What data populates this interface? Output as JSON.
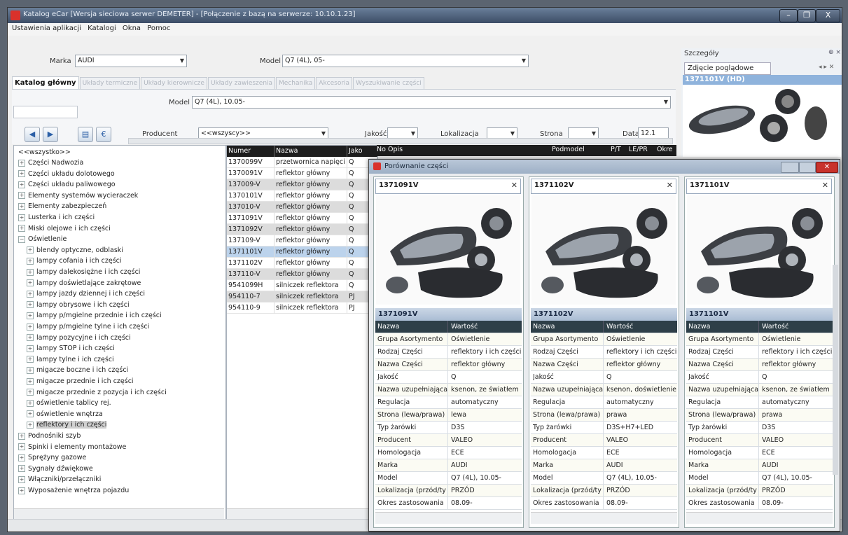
{
  "window": {
    "title": "Katalog eCar [Wersja sieciowa serwer DEMETER]  -  [Połączenie z bazą na serwerze: 10.10.1.23]",
    "minimize": "–",
    "maximize": "❐",
    "close": "X"
  },
  "menu": [
    "Ustawienia aplikacji",
    "Katalogi",
    "Okna",
    "Pomoc"
  ],
  "top_filters": {
    "marka_label": "Marka",
    "marka_value": "AUDI",
    "model_label": "Model",
    "model_value": "Q7 (4L), 05-"
  },
  "tabs": [
    "Katalog główny",
    "Układy termiczne",
    "Układy kierownicze",
    "Układy zawieszenia",
    "Mechanika",
    "Akcesoria",
    "Wyszukiwanie części"
  ],
  "filters": {
    "model_label": "Model",
    "model_value": "Q7 (4L), 10.05-",
    "producent_label": "Producent",
    "producent_value": "<<wszyscy>>",
    "jakosc_label": "Jakość",
    "lokalizacja_label": "Lokalizacja",
    "strona_label": "Strona",
    "data_label": "Data",
    "data_value": "12.1"
  },
  "tree": {
    "root": "<<wszystko>>",
    "items": [
      {
        "label": "Części Nadwozia",
        "level": 0,
        "expander": "+"
      },
      {
        "label": "Części układu dolotowego",
        "level": 0,
        "expander": "+"
      },
      {
        "label": "Części układu paliwowego",
        "level": 0,
        "expander": "+"
      },
      {
        "label": "Elementy systemów wycieraczek",
        "level": 0,
        "expander": "+"
      },
      {
        "label": "Elementy zabezpieczeń",
        "level": 0,
        "expander": "+"
      },
      {
        "label": "Lusterka i ich części",
        "level": 0,
        "expander": "+"
      },
      {
        "label": "Miski olejowe i ich części",
        "level": 0,
        "expander": "+"
      },
      {
        "label": "Oświetlenie",
        "level": 0,
        "expander": "−"
      },
      {
        "label": "blendy optyczne, odblaski",
        "level": 1,
        "expander": "+"
      },
      {
        "label": "lampy cofania i ich części",
        "level": 1,
        "expander": "+"
      },
      {
        "label": "lampy dalekosiężne i ich części",
        "level": 1,
        "expander": "+"
      },
      {
        "label": "lampy doświetlające zakrętowe",
        "level": 1,
        "expander": "+"
      },
      {
        "label": "lampy jazdy dziennej i ich części",
        "level": 1,
        "expander": "+"
      },
      {
        "label": "lampy obrysowe i ich części",
        "level": 1,
        "expander": "+"
      },
      {
        "label": "lampy p/mgielne przednie i ich części",
        "level": 1,
        "expander": "+"
      },
      {
        "label": "lampy p/mgielne tylne i ich części",
        "level": 1,
        "expander": "+"
      },
      {
        "label": "lampy pozycyjne i ich części",
        "level": 1,
        "expander": "+"
      },
      {
        "label": "lampy STOP i ich części",
        "level": 1,
        "expander": "+"
      },
      {
        "label": "lampy tylne i ich części",
        "level": 1,
        "expander": "+"
      },
      {
        "label": "migacze boczne i ich części",
        "level": 1,
        "expander": "+"
      },
      {
        "label": "migacze przednie i ich części",
        "level": 1,
        "expander": "+"
      },
      {
        "label": "migacze przednie z pozycja i ich części",
        "level": 1,
        "expander": "+"
      },
      {
        "label": "oświetlenie tablicy rej.",
        "level": 1,
        "expander": "+"
      },
      {
        "label": "oświetlenie wnętrza",
        "level": 1,
        "expander": "+"
      },
      {
        "label": "reflektory i ich części",
        "level": 1,
        "expander": "+",
        "selected": true
      },
      {
        "label": "Podnośniki szyb",
        "level": 0,
        "expander": "+"
      },
      {
        "label": "Spinki i elementy montażowe",
        "level": 0,
        "expander": "+"
      },
      {
        "label": "Sprężyny gazowe",
        "level": 0,
        "expander": "+"
      },
      {
        "label": "Sygnały dźwiękowe",
        "level": 0,
        "expander": "+"
      },
      {
        "label": "Włączniki/przełączniki",
        "level": 0,
        "expander": "+"
      },
      {
        "label": "Wyposażenie wnętrza pojazdu",
        "level": 0,
        "expander": "+"
      }
    ]
  },
  "grid": {
    "headers": [
      "Numer",
      "Nazwa",
      "Jako",
      "No",
      "Opis",
      "Podmodel",
      "P/T",
      "LE/PR",
      "Okre"
    ],
    "rows": [
      {
        "numer": "1370099V",
        "nazwa": "przetwornica napięci",
        "jakosc": "Q",
        "shade": false
      },
      {
        "numer": "1370091V",
        "nazwa": "reflektor główny",
        "jakosc": "Q",
        "shade": false
      },
      {
        "numer": "137009-V",
        "nazwa": "reflektor główny",
        "jakosc": "Q",
        "shade": true
      },
      {
        "numer": "1370101V",
        "nazwa": "reflektor główny",
        "jakosc": "Q",
        "shade": false
      },
      {
        "numer": "137010-V",
        "nazwa": "reflektor główny",
        "jakosc": "Q",
        "shade": true
      },
      {
        "numer": "1371091V",
        "nazwa": "reflektor główny",
        "jakosc": "Q",
        "shade": false
      },
      {
        "numer": "1371092V",
        "nazwa": "reflektor główny",
        "jakosc": "Q",
        "shade": true
      },
      {
        "numer": "137109-V",
        "nazwa": "reflektor główny",
        "jakosc": "Q",
        "shade": false
      },
      {
        "numer": "1371101V",
        "nazwa": "reflektor główny",
        "jakosc": "Q",
        "shade": false,
        "selected": true
      },
      {
        "numer": "1371102V",
        "nazwa": "reflektor główny",
        "jakosc": "Q",
        "shade": false
      },
      {
        "numer": "137110-V",
        "nazwa": "reflektor główny",
        "jakosc": "Q",
        "shade": true
      },
      {
        "numer": "9541099H",
        "nazwa": "silniczek reflektora",
        "jakosc": "Q",
        "shade": false
      },
      {
        "numer": "954110-7",
        "nazwa": "silniczek reflektora",
        "jakosc": "PJ",
        "shade": true
      },
      {
        "numer": "954110-9",
        "nazwa": "silniczek reflektora",
        "jakosc": "PJ",
        "shade": false
      }
    ]
  },
  "details": {
    "title": "Szczegóły",
    "tab": "Zdjęcie poglądowe",
    "part": "1371101V  (HD)"
  },
  "compare": {
    "title": "Porównanie części",
    "header_key": "Nazwa",
    "header_val": "Wartość",
    "panels": [
      {
        "tab": "1371091V",
        "part": "1371091V",
        "rows": [
          [
            "Grupa Asortymento",
            "Oświetlenie"
          ],
          [
            "Rodzaj Części",
            "reflektory i ich części"
          ],
          [
            "Nazwa Części",
            "reflektor główny"
          ],
          [
            "Jakość",
            "Q"
          ],
          [
            "Nazwa uzupełniająca",
            "ksenon, ze światłem do"
          ],
          [
            "Regulacja",
            "automatyczny"
          ],
          [
            "Strona (lewa/prawa)",
            "lewa"
          ],
          [
            "Typ żarówki",
            "D3S"
          ],
          [
            "Producent",
            "VALEO"
          ],
          [
            "Homologacja",
            "ECE"
          ],
          [
            "Marka",
            "AUDI"
          ],
          [
            "Model",
            "Q7 (4L), 10.05-"
          ],
          [
            "Lokalizacja (przód/ty",
            "PRZÓD"
          ],
          [
            "Okres zastosowania",
            "08.09-"
          ]
        ]
      },
      {
        "tab": "1371102V",
        "part": "1371102V",
        "rows": [
          [
            "Grupa Asortymento",
            "Oświetlenie"
          ],
          [
            "Rodzaj Części",
            "reflektory i ich części"
          ],
          [
            "Nazwa Części",
            "reflektor główny"
          ],
          [
            "Jakość",
            "Q"
          ],
          [
            "Nazwa uzupełniająca",
            "ksenon, doświetlenie z"
          ],
          [
            "Regulacja",
            "automatyczny"
          ],
          [
            "Strona (lewa/prawa)",
            "prawa"
          ],
          [
            "Typ żarówki",
            "D3S+H7+LED"
          ],
          [
            "Producent",
            "VALEO"
          ],
          [
            "Homologacja",
            "ECE"
          ],
          [
            "Marka",
            "AUDI"
          ],
          [
            "Model",
            "Q7 (4L), 10.05-"
          ],
          [
            "Lokalizacja (przód/ty",
            "PRZÓD"
          ],
          [
            "Okres zastosowania",
            "08.09-"
          ]
        ]
      },
      {
        "tab": "1371101V",
        "part": "1371101V",
        "rows": [
          [
            "Grupa Asortymento",
            "Oświetlenie"
          ],
          [
            "Rodzaj Części",
            "reflektory i ich części"
          ],
          [
            "Nazwa Części",
            "reflektor główny"
          ],
          [
            "Jakość",
            "Q"
          ],
          [
            "Nazwa uzupełniająca",
            "ksenon, ze światłem do"
          ],
          [
            "Regulacja",
            "automatyczny"
          ],
          [
            "Strona (lewa/prawa)",
            "prawa"
          ],
          [
            "Typ żarówki",
            "D3S"
          ],
          [
            "Producent",
            "VALEO"
          ],
          [
            "Homologacja",
            "ECE"
          ],
          [
            "Marka",
            "AUDI"
          ],
          [
            "Model",
            "Q7 (4L), 10.05-"
          ],
          [
            "Lokalizacja (przód/ty",
            "PRZÓD"
          ],
          [
            "Okres zastosowania",
            "08.09-"
          ]
        ]
      }
    ]
  },
  "icons": {
    "nav": [
      "back-icon",
      "forward-icon",
      "export-icon",
      "euro-icon"
    ],
    "headlight": "headlight-photo-icon"
  },
  "colors": {
    "titlebar": "#3c4d66",
    "grid_header": "#1d1d1d",
    "selection": "#bcd3ec",
    "panel_header": "#2e3f48",
    "close_red": "#c8322c"
  }
}
